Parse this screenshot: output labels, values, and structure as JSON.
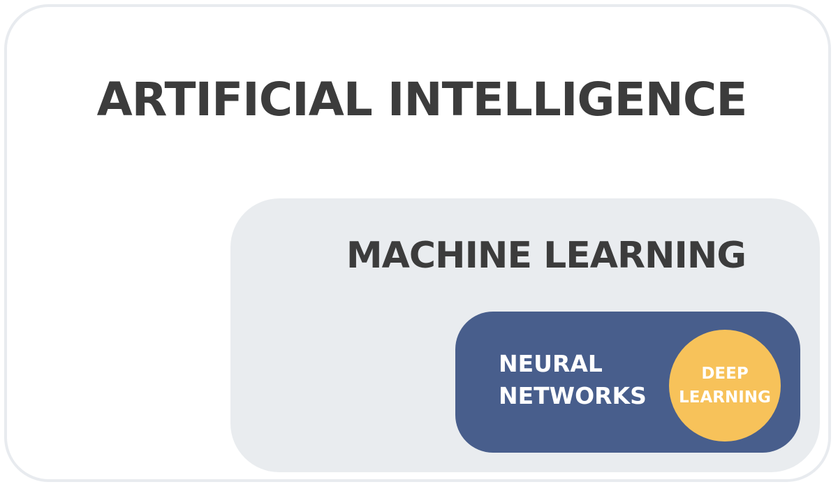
{
  "diagram": {
    "outer": {
      "label": "ARTIFICIAL INTELLIGENCE",
      "color": "#ffffff",
      "border_color": "#e8ebef"
    },
    "middle": {
      "label": "MACHINE LEARNING",
      "color": "#e9ecef"
    },
    "inner": {
      "label_lines": [
        "NEURAL",
        "NETWORKS"
      ],
      "color": "#485e8c"
    },
    "core": {
      "label_lines": [
        "DEEP",
        "LEARNING"
      ],
      "color": "#f7c25a"
    }
  }
}
